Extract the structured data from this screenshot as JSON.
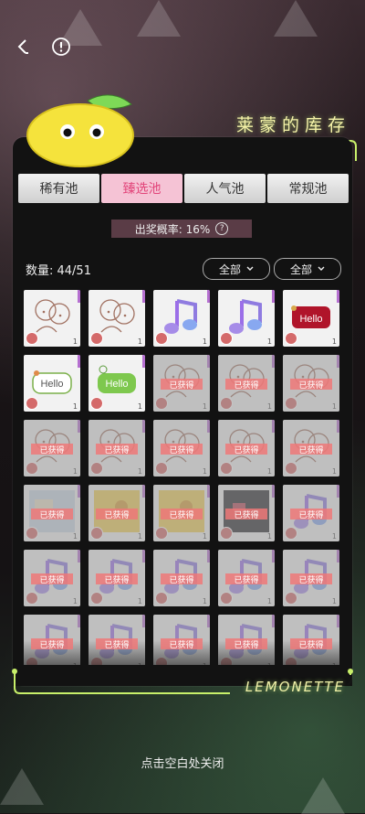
{
  "header": {
    "title": "莱蒙的库存"
  },
  "tabs": [
    "稀有池",
    "臻选池",
    "人气池",
    "常规池"
  ],
  "active_tab": "臻选池",
  "probability": {
    "label": "出奖概率: 16%"
  },
  "count": {
    "label": "数量: 44/51"
  },
  "filters": [
    "全部",
    "全部"
  ],
  "owned_label": "已获得",
  "hello_label": "Hello",
  "card_count_label": "1",
  "brand": "LEMONETTE",
  "close_hint": "点击空白处关闭",
  "colors": {
    "accent": "#e2457a",
    "neon": "#c8f06a",
    "rarity": "#b56fd0",
    "owned_tag": "#ee7878"
  },
  "icons": {
    "back": "chevron-left-icon",
    "info": "exclamation-circle-icon",
    "help": "question-circle-icon",
    "dropdown": "chevron-down-icon"
  },
  "grid": {
    "columns": 5,
    "items": [
      {
        "art": "babies",
        "owned": false
      },
      {
        "art": "babies",
        "owned": false
      },
      {
        "art": "note",
        "owned": false
      },
      {
        "art": "note",
        "owned": false
      },
      {
        "art": "hello-red",
        "owned": false
      },
      {
        "art": "hello-white",
        "owned": false
      },
      {
        "art": "hello-green",
        "owned": false
      },
      {
        "art": "babies",
        "owned": true
      },
      {
        "art": "babies",
        "owned": true
      },
      {
        "art": "babies",
        "owned": true
      },
      {
        "art": "babies",
        "owned": true
      },
      {
        "art": "babies",
        "owned": true
      },
      {
        "art": "babies",
        "owned": true
      },
      {
        "art": "babies",
        "owned": true
      },
      {
        "art": "babies",
        "owned": true
      },
      {
        "art": "photo-blue",
        "owned": true
      },
      {
        "art": "photo-yellow",
        "owned": true
      },
      {
        "art": "photo-yellow",
        "owned": true
      },
      {
        "art": "photo-dark",
        "owned": true
      },
      {
        "art": "note",
        "owned": true
      },
      {
        "art": "note",
        "owned": true
      },
      {
        "art": "note",
        "owned": true
      },
      {
        "art": "note",
        "owned": true
      },
      {
        "art": "note",
        "owned": true
      },
      {
        "art": "note",
        "owned": true
      },
      {
        "art": "note",
        "owned": true
      },
      {
        "art": "note",
        "owned": true
      },
      {
        "art": "note",
        "owned": true
      },
      {
        "art": "note",
        "owned": true
      },
      {
        "art": "note",
        "owned": true
      }
    ]
  }
}
